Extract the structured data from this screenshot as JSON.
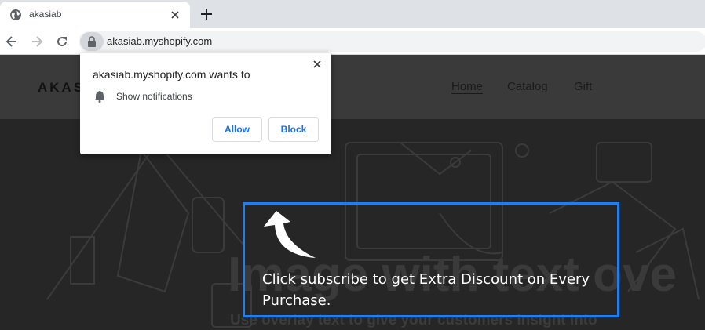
{
  "browser": {
    "tab": {
      "title": "akasiab",
      "favicon": "globe-icon"
    },
    "url": "akasiab.myshopify.com"
  },
  "site": {
    "logo": "AKAS",
    "nav": [
      {
        "label": "Home",
        "active": true
      },
      {
        "label": "Catalog",
        "active": false
      },
      {
        "label": "Gift",
        "active": false
      }
    ],
    "hero": {
      "title": "Image with text ove",
      "subtitle": "Use overlay text to give your customers insight into"
    },
    "callout": {
      "text": "Click subscribe to get Extra Discount on Every Purchase.",
      "border_color": "#1f7ef0"
    }
  },
  "popup": {
    "title": "akasiab.myshopify.com wants to",
    "permission": "Show notifications",
    "allow_label": "Allow",
    "block_label": "Block"
  }
}
